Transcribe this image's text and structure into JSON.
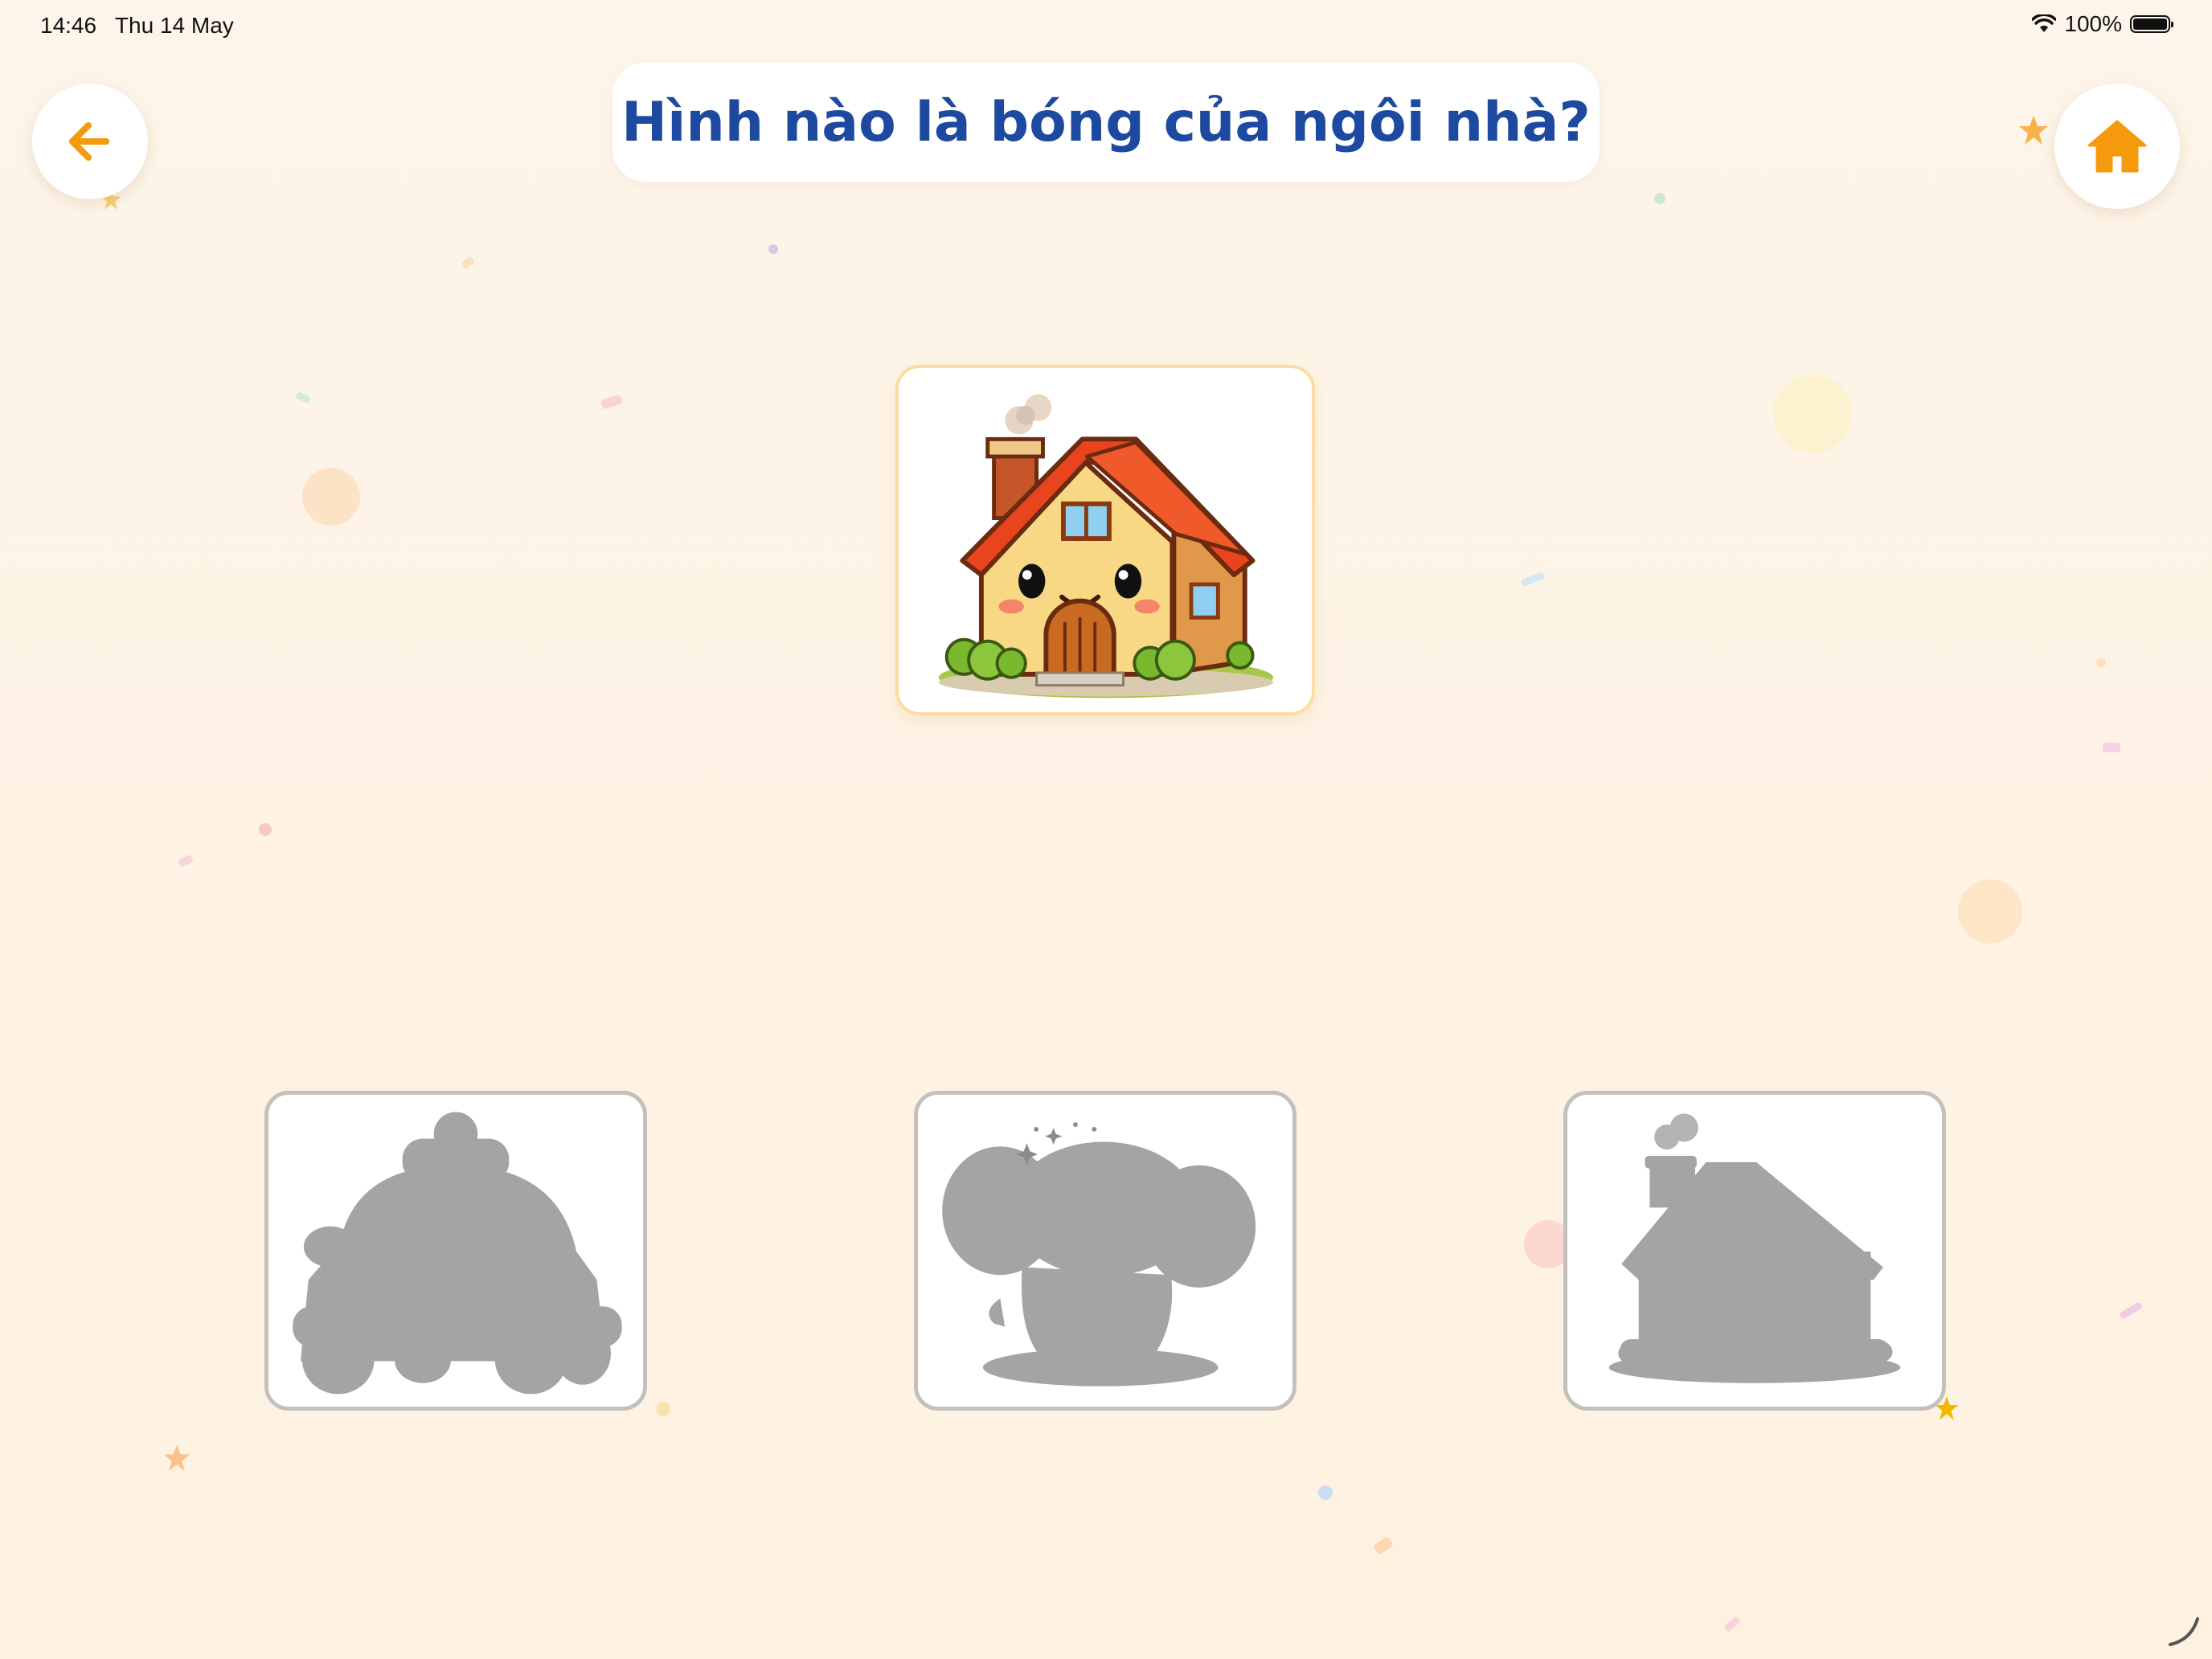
{
  "status_bar": {
    "time": "14:46",
    "date": "Thu 14 May",
    "battery": "100%",
    "icons": [
      "wifi-icon",
      "battery-icon"
    ]
  },
  "nav": {
    "back_icon": "arrow-left-icon",
    "home_icon": "home-icon",
    "accent_color": "#f59a0c"
  },
  "question": {
    "text": "Hình nào là bóng của ngôi nhà?",
    "color": "#1d4aa0"
  },
  "target": {
    "image": "cartoon-house-picture",
    "border_color": "#fbdca5"
  },
  "options": [
    {
      "image": "car-silhouette"
    },
    {
      "image": "elephant-silhouette"
    },
    {
      "image": "house-silhouette"
    }
  ],
  "colors": {
    "background": "#fdf5ea",
    "silhouette": "#a4a4a4",
    "option_border": "#c4c1bd"
  }
}
